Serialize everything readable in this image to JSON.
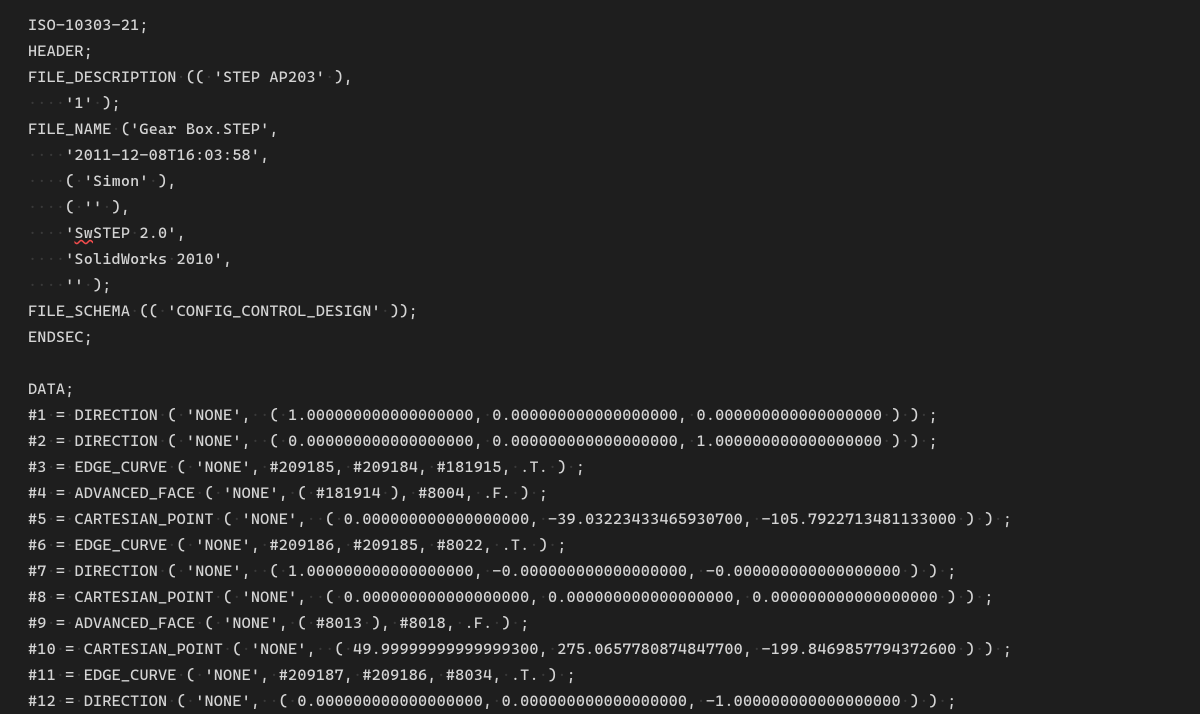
{
  "file_format": "ISO-10303-21",
  "whitespace_glyph": "·",
  "header": {
    "file_description": {
      "description": "STEP AP203",
      "implementation_level": "1"
    },
    "file_name": {
      "name": "Gear Box.STEP",
      "timestamp": "2011-12-08T16:03:58",
      "author": "Simon",
      "organization": "",
      "preprocessor_version": "SwSTEP 2.0",
      "preprocessor_squiggle": "Sw",
      "originating_system": "SolidWorks 2010",
      "authorization": ""
    },
    "file_schema": "CONFIG_CONTROL_DESIGN"
  },
  "data": [
    {
      "id": 1,
      "entity": "DIRECTION",
      "args": "'NONE',  ( 1.000000000000000000, 0.000000000000000000, 0.000000000000000000 ) "
    },
    {
      "id": 2,
      "entity": "DIRECTION",
      "args": "'NONE',  ( 0.000000000000000000, 0.000000000000000000, 1.000000000000000000 ) "
    },
    {
      "id": 3,
      "entity": "EDGE_CURVE",
      "args": "'NONE', #209185, #209184, #181915, .T. "
    },
    {
      "id": 4,
      "entity": "ADVANCED_FACE",
      "args": "'NONE', ( #181914 ), #8004, .F. "
    },
    {
      "id": 5,
      "entity": "CARTESIAN_POINT",
      "args": "'NONE',  ( 0.000000000000000000, -39.03223433465930700, -105.7922713481133000 ) "
    },
    {
      "id": 6,
      "entity": "EDGE_CURVE",
      "args": "'NONE', #209186, #209185, #8022, .T. "
    },
    {
      "id": 7,
      "entity": "DIRECTION",
      "args": "'NONE',  ( 1.000000000000000000, -0.000000000000000000, -0.000000000000000000 ) "
    },
    {
      "id": 8,
      "entity": "CARTESIAN_POINT",
      "args": "'NONE',  ( 0.000000000000000000, 0.000000000000000000, 0.000000000000000000 ) "
    },
    {
      "id": 9,
      "entity": "ADVANCED_FACE",
      "args": "'NONE', ( #8013 ), #8018, .F. "
    },
    {
      "id": 10,
      "entity": "CARTESIAN_POINT",
      "args": "'NONE',  ( 49.99999999999999300, 275.0657780874847700, -199.8469857794372600 ) "
    },
    {
      "id": 11,
      "entity": "EDGE_CURVE",
      "args": "'NONE', #209187, #209186, #8034, .T. "
    },
    {
      "id": 12,
      "entity": "DIRECTION",
      "args": "'NONE',  ( 0.000000000000000000, 0.000000000000000000, -1.000000000000000000 ) "
    }
  ]
}
